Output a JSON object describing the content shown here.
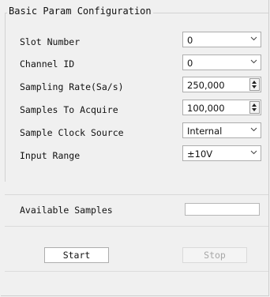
{
  "group": {
    "title": "Basic Param Configuration"
  },
  "fields": [
    {
      "label": "Slot Number",
      "value": "0",
      "control": "combo"
    },
    {
      "label": "Channel ID",
      "value": "0",
      "control": "combo"
    },
    {
      "label": "Sampling Rate(Sa/s)",
      "value": "250,000",
      "control": "spinbox"
    },
    {
      "label": "Samples To Acquire",
      "value": "100,000",
      "control": "spinbox"
    },
    {
      "label": "Sample Clock Source",
      "value": "Internal",
      "control": "combo"
    },
    {
      "label": "Input Range",
      "value": "±10V",
      "control": "combo"
    }
  ],
  "available": {
    "label": "Available Samples",
    "value": ""
  },
  "buttons": {
    "start": "Start",
    "stop": "Stop"
  },
  "icons": {
    "combo_arrow": "chevron-down-icon",
    "spin": "spin-up-down-icon"
  },
  "colors": {
    "background": "#f0f0f0",
    "border": "#adadad",
    "disabled_text": "#a7a7a7"
  }
}
